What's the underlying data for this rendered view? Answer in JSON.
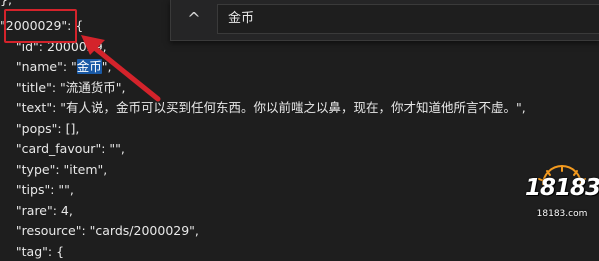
{
  "editor": {
    "lines": [
      "},",
      "\"2000029\": {",
      "    \"id\": 2000029,",
      "    \"name\": \"金币\",",
      "    \"title\": \"流通货币\",",
      "    \"text\": \"有人说，金币可以买到任何东西。你以前嗤之以鼻，现在，你才知道他所言不虚。\",",
      "    \"pops\": [],",
      "    \"card_favour\": \"\",",
      "    \"type\": \"item\",",
      "    \"tips\": \"\",",
      "    \"rare\": 4,",
      "    \"resource\": \"cards/2000029\",",
      "    \"tag\": {"
    ],
    "name_line": {
      "prefix": "    \"name\": \"",
      "match": "金币",
      "suffix": "\","
    }
  },
  "find": {
    "toggle_label": "^",
    "query": "金币"
  },
  "watermark": {
    "text_main": "18183",
    "text_sub": "18183.com"
  },
  "annotation": {
    "box_color": "#d4232b",
    "arrow_color": "#d4232b"
  }
}
